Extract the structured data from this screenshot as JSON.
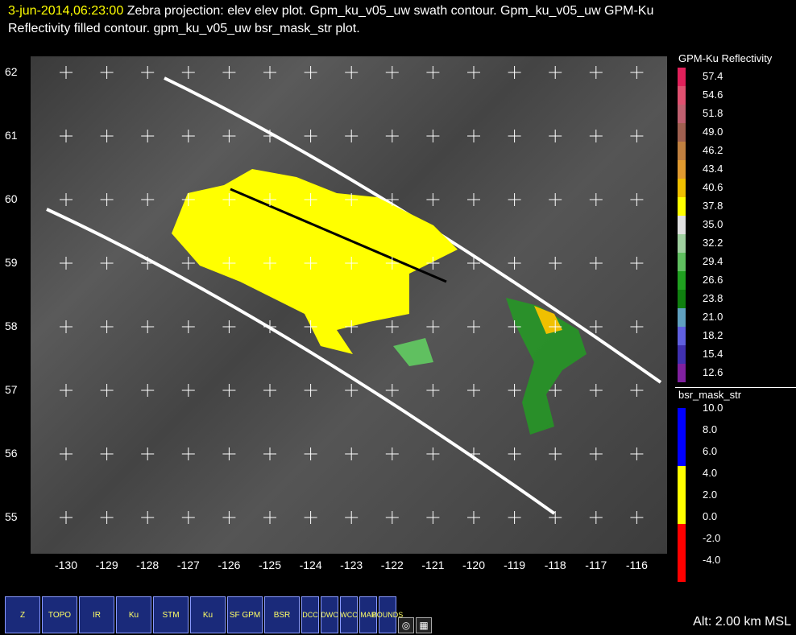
{
  "title": {
    "timestamp": "3-jun-2014,06:23:00",
    "line1_rest": "Zebra projection: elev elev  plot.  Gpm_ku_v05_uw swath contour.  Gpm_ku_v05_uw GPM-Ku",
    "line2": "Reflectivity filled contour.  gpm_ku_v05_uw bsr_mask_str  plot."
  },
  "axes": {
    "lat_labels": [
      "62",
      "61",
      "60",
      "59",
      "58",
      "57",
      "56",
      "55"
    ],
    "lon_labels": [
      "-130",
      "-129",
      "-128",
      "-127",
      "-126",
      "-125",
      "-124",
      "-123",
      "-122",
      "-121",
      "-120",
      "-119",
      "-118",
      "-117",
      "-116"
    ]
  },
  "legend_reflectivity": {
    "title": "GPM-Ku Reflectivity",
    "labels": [
      "57.4",
      "54.6",
      "51.8",
      "49.0",
      "46.2",
      "43.4",
      "40.6",
      "37.8",
      "35.0",
      "32.2",
      "29.4",
      "26.6",
      "23.8",
      "21.0",
      "18.2",
      "15.4",
      "12.6"
    ],
    "colors": [
      "#e0205a",
      "#e05070",
      "#c06070",
      "#a06050",
      "#c08040",
      "#e09a30",
      "#f0c000",
      "#ffff00",
      "#e0e0e0",
      "#a0d0a0",
      "#60c060",
      "#20a020",
      "#108010",
      "#60a0c0",
      "#6060e0",
      "#4030b0",
      "#8020a0"
    ]
  },
  "legend_mask": {
    "title": "bsr_mask_str",
    "labels": [
      "10.0",
      "8.0",
      "6.0",
      "4.0",
      "2.0",
      "0.0",
      "-2.0",
      "-4.0"
    ],
    "colors": [
      "#0000ff",
      "#0000ff",
      "#ffff00",
      "#ffff00",
      "#ff0000",
      "#ff0000"
    ]
  },
  "toolbar": {
    "buttons": [
      "Z",
      "TOPO",
      "IR",
      "Ku",
      "STM",
      "Ku",
      "SF GPM",
      "BSR",
      "DCC",
      "DWC",
      "WCC",
      "MAP",
      "BOUNDS"
    ]
  },
  "status": {
    "altitude": "Alt: 2.00 km MSL"
  }
}
